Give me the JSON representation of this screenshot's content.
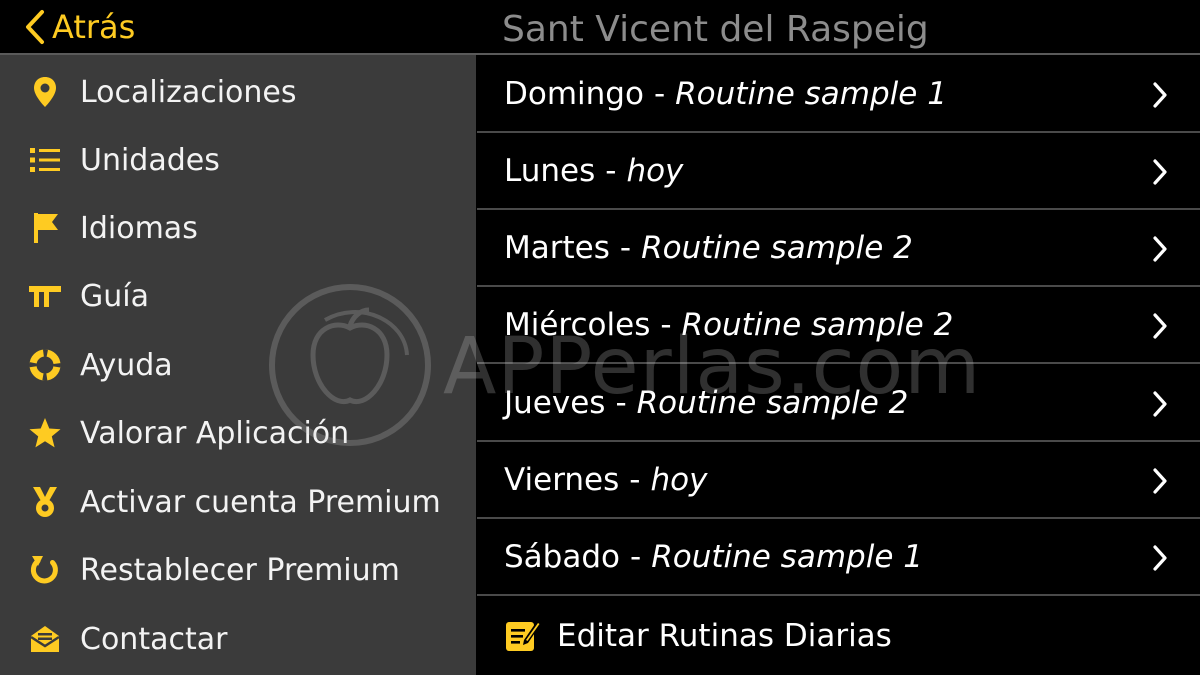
{
  "colors": {
    "accent": "#fecb22",
    "sidebar_bg": "#3b3b3b",
    "list_bg": "#000000",
    "title": "#8c8c8c"
  },
  "nav": {
    "back_label": "Atrás",
    "city": "Sant Vicent del Raspeig"
  },
  "sidebar": {
    "items": [
      {
        "label": "Localizaciones",
        "icon": "location-pin-icon"
      },
      {
        "label": "Unidades",
        "icon": "list-icon"
      },
      {
        "label": "Idiomas",
        "icon": "flag-icon"
      },
      {
        "label": "Guía",
        "icon": "guide-icon"
      },
      {
        "label": "Ayuda",
        "icon": "lifebuoy-icon"
      },
      {
        "label": "Valorar Aplicación",
        "icon": "star-icon"
      },
      {
        "label": "Activar cuenta Premium",
        "icon": "medal-icon"
      },
      {
        "label": "Restablecer Premium",
        "icon": "restore-icon"
      },
      {
        "label": "Contactar",
        "icon": "mail-icon"
      }
    ]
  },
  "routines": [
    {
      "day": "Domingo",
      "routine": "Routine sample 1"
    },
    {
      "day": "Lunes",
      "routine": "hoy"
    },
    {
      "day": "Martes",
      "routine": "Routine sample 2"
    },
    {
      "day": "Miércoles",
      "routine": "Routine sample 2"
    },
    {
      "day": "Jueves",
      "routine": "Routine sample 2"
    },
    {
      "day": "Viernes",
      "routine": "hoy"
    },
    {
      "day": "Sábado",
      "routine": "Routine sample 1"
    }
  ],
  "separator": "-",
  "edit": {
    "label": "Editar Rutinas Diarias",
    "icon": "edit-icon"
  },
  "watermark": {
    "text": "APPerlas.com"
  }
}
